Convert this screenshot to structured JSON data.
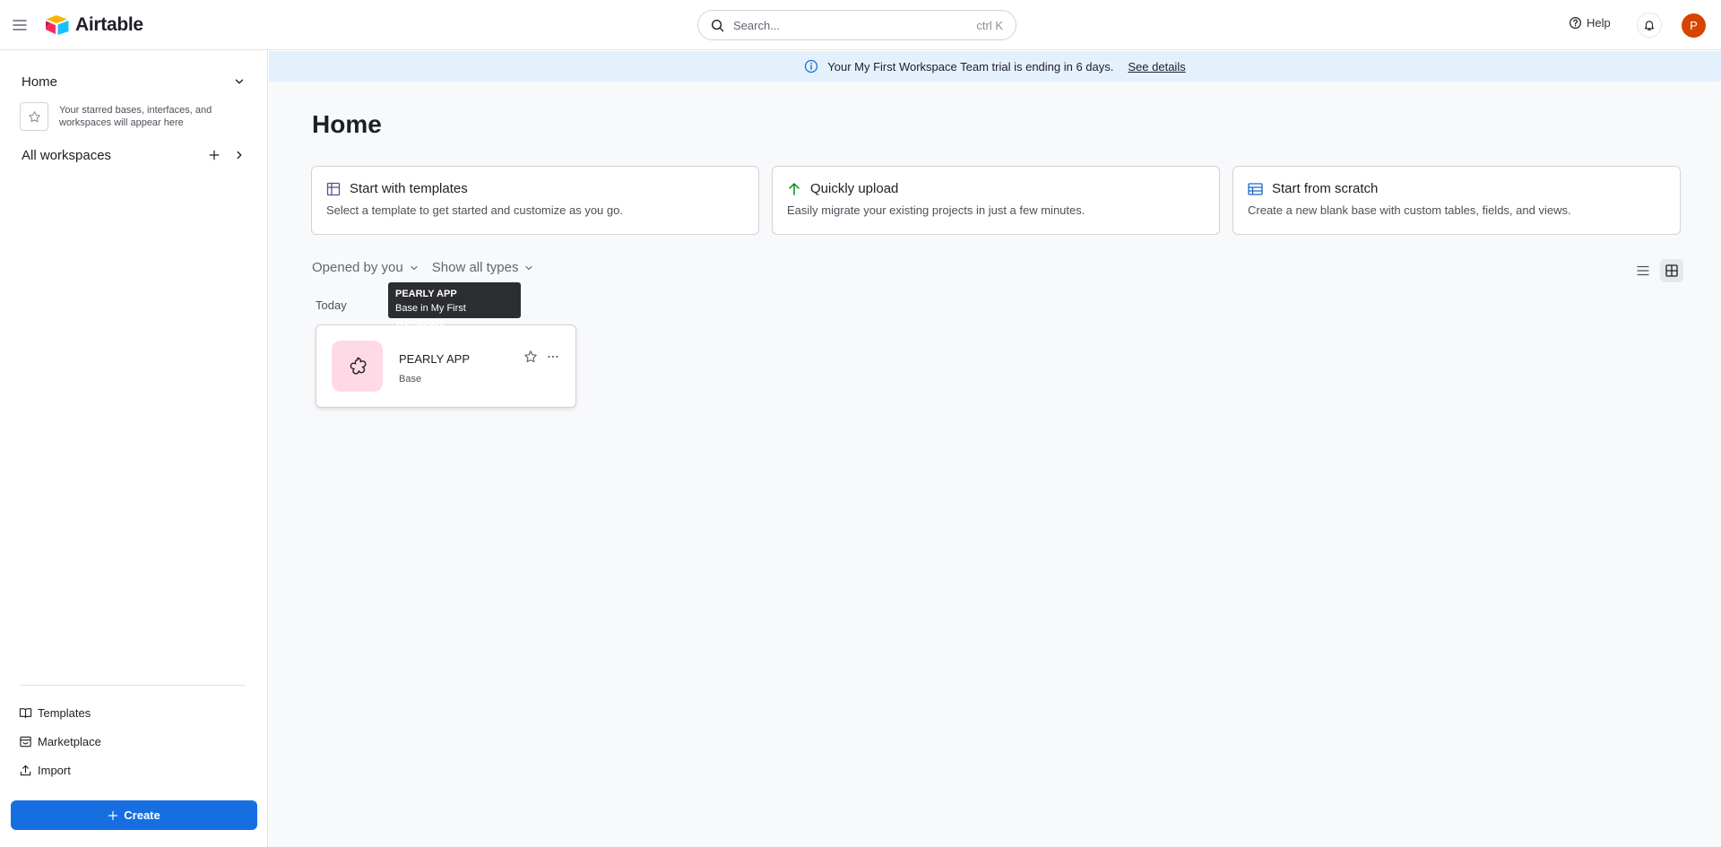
{
  "topbar": {
    "app_name": "Airtable",
    "search_placeholder": "Search...",
    "search_shortcut": "ctrl K",
    "help_label": "Help",
    "avatar_initial": "P"
  },
  "sidebar": {
    "home_label": "Home",
    "starred_empty_text": "Your starred bases, interfaces, and workspaces will appear here",
    "all_workspaces_label": "All workspaces",
    "links": {
      "templates": "Templates",
      "marketplace": "Marketplace",
      "import": "Import"
    },
    "create_label": "Create"
  },
  "banner": {
    "message": "Your My First Workspace Team trial is ending in 6 days.",
    "link": "See details"
  },
  "main": {
    "title": "Home",
    "cards": [
      {
        "icon": "grid-icon",
        "title": "Start with templates",
        "description": "Select a template to get started and customize as you go."
      },
      {
        "icon": "upload-arrow-icon",
        "title": "Quickly upload",
        "description": "Easily migrate your existing projects in just a few minutes."
      },
      {
        "icon": "table-icon",
        "title": "Start from scratch",
        "description": "Create a new blank base with custom tables, fields, and views."
      }
    ],
    "filters": {
      "opened_by": "Opened by you",
      "types": "Show all types"
    },
    "view_mode": "grid",
    "section_label": "Today",
    "tooltip": {
      "title": "PEARLY APP",
      "subtitle": "Base in My First Workspace"
    },
    "bases": [
      {
        "name": "PEARLY APP",
        "type": "Base",
        "icon": "flower-icon"
      }
    ]
  },
  "colors": {
    "accent": "#166ee1",
    "banner_bg": "#e5f0fd",
    "avatar_bg": "#d54401",
    "base_icon_bg": "#ffd9e5"
  }
}
